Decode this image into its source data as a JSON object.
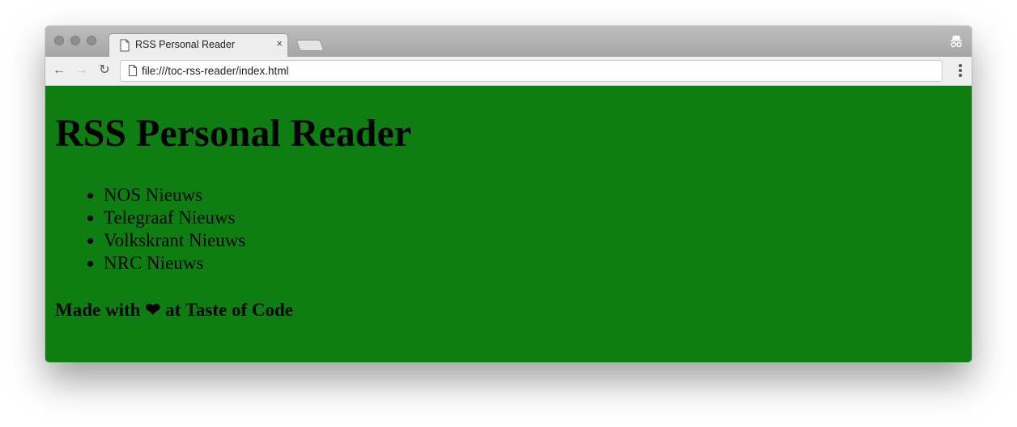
{
  "browser": {
    "tab": {
      "title": "RSS Personal Reader",
      "close_glyph": "×",
      "icon": "document-icon"
    },
    "address_bar": {
      "url": "file:///toc-rss-reader/index.html",
      "icon": "document-icon"
    },
    "nav": {
      "back_glyph": "←",
      "forward_glyph": "→",
      "reload_glyph": "↻"
    },
    "incognito_icon": "incognito-icon"
  },
  "page": {
    "background_color": "#0f7e12",
    "heading": "RSS Personal Reader",
    "feeds": [
      {
        "label": "NOS Nieuws"
      },
      {
        "label": "Telegraaf Nieuws"
      },
      {
        "label": "Volkskrant Nieuws"
      },
      {
        "label": "NRC Nieuws"
      }
    ],
    "footer": "Made with ❤ at Taste of Code"
  }
}
